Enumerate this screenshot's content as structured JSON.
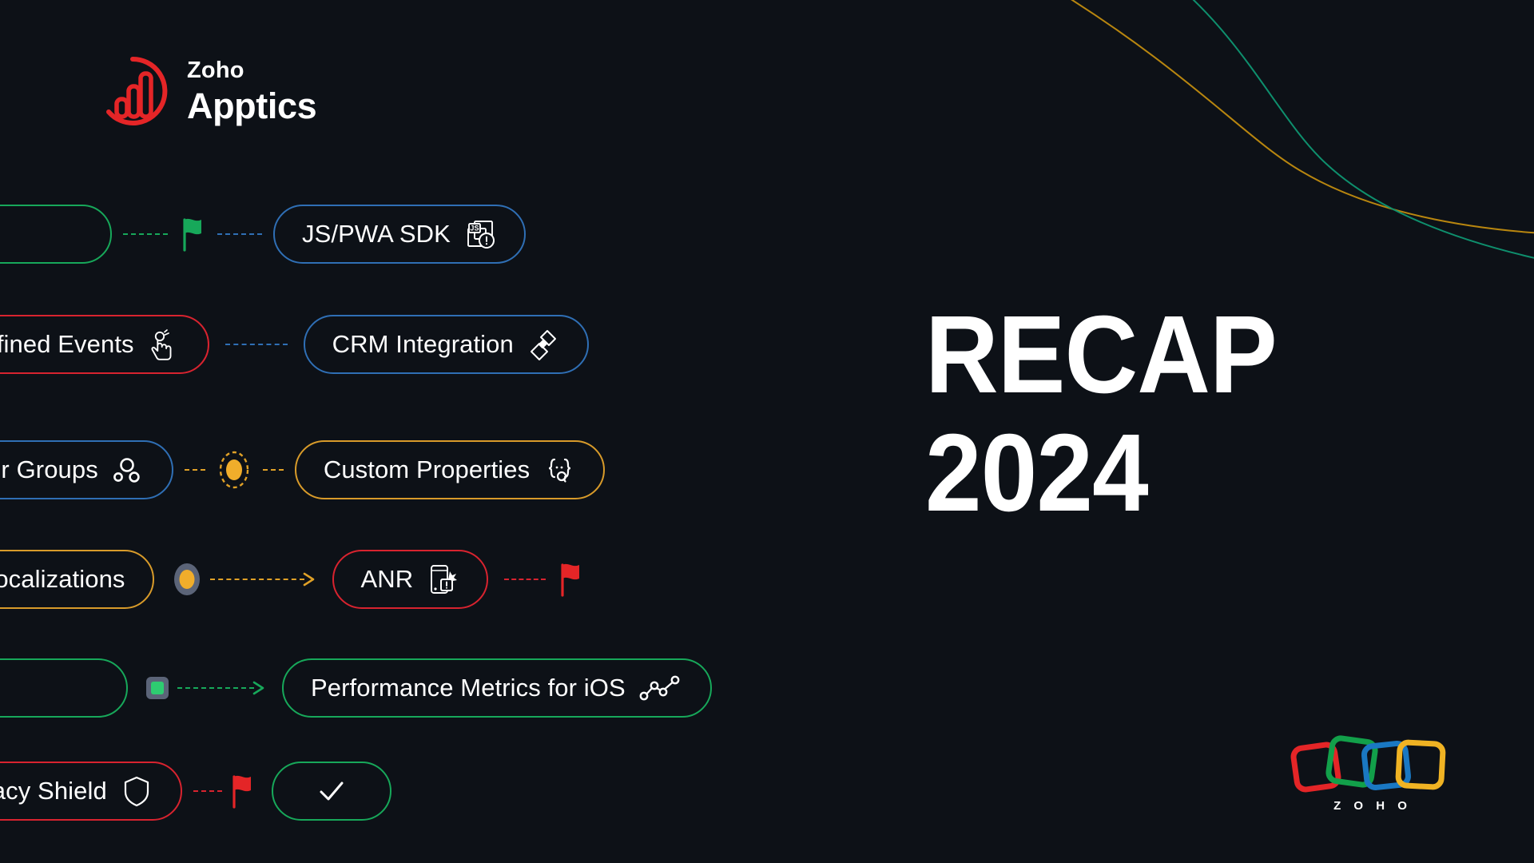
{
  "brand": {
    "logo_icon": "apptics-bar-chart-circle-icon",
    "name_top": "Zoho",
    "name_bottom": "Apptics",
    "accent": "#e42527"
  },
  "headline": {
    "line1": "RECAP",
    "line2": "2024",
    "color": "#ffffff"
  },
  "background": {
    "color": "#0d1117",
    "decorative_curves": [
      {
        "name": "amber-curve",
        "color": "#b8860f"
      },
      {
        "name": "teal-curve",
        "color": "#0e8f6d"
      }
    ]
  },
  "colors": {
    "green": "#17a85a",
    "blue": "#2f6fb5",
    "red": "#d8232f",
    "orange": "#d89b2a",
    "amber_dot": "#f0ad2b",
    "marker_bg": "#5b6478"
  },
  "feature_rows": [
    {
      "id": "row-js-pwa-sdk",
      "items": [
        {
          "type": "pill",
          "name": "pill-partial-green",
          "label": "",
          "color": "green",
          "icon": null,
          "partial": true
        },
        {
          "type": "dash",
          "name": "connector-dashed-green",
          "color": "green",
          "length": 56
        },
        {
          "type": "flag",
          "name": "flag-green-icon",
          "color": "green"
        },
        {
          "type": "dash",
          "name": "connector-dashed-blue",
          "color": "blue",
          "length": 56
        },
        {
          "type": "pill",
          "name": "pill-js-pwa-sdk",
          "label": "JS/PWA SDK",
          "color": "blue",
          "icon": "js-sdk-alert-icon"
        }
      ]
    },
    {
      "id": "row-defined-events",
      "items": [
        {
          "type": "pill",
          "name": "pill-defined-events",
          "label": "Defined Events",
          "color": "red",
          "icon": "tap-cursor-icon"
        },
        {
          "type": "dash",
          "name": "connector-dashed-blue",
          "color": "blue",
          "length": 78
        },
        {
          "type": "pill",
          "name": "pill-crm-integration",
          "label": "CRM Integration",
          "color": "blue",
          "icon": "puzzle-integration-icon"
        }
      ]
    },
    {
      "id": "row-user-groups",
      "items": [
        {
          "type": "pill",
          "name": "pill-user-groups",
          "label": "User Groups",
          "color": "blue",
          "icon": "user-groups-circles-icon"
        },
        {
          "type": "dash",
          "name": "connector-dashed-orange",
          "color": "orange",
          "length": 26
        },
        {
          "type": "marker",
          "name": "marker-dot-dashed-ring",
          "style": "dot-ring",
          "color": "orange"
        },
        {
          "type": "dash",
          "name": "connector-dashed-orange",
          "color": "orange",
          "length": 26
        },
        {
          "type": "pill",
          "name": "pill-custom-properties",
          "label": "Custom Properties",
          "color": "orange",
          "icon": "braces-query-icon"
        }
      ]
    },
    {
      "id": "row-localizations",
      "items": [
        {
          "type": "pill",
          "name": "pill-localizations",
          "label": "Localizations",
          "color": "orange",
          "icon": null
        },
        {
          "type": "marker",
          "name": "marker-dot-pill",
          "style": "dot-pill",
          "color": "orange"
        },
        {
          "type": "arrow",
          "name": "connector-arrow-orange",
          "color": "orange",
          "length": 118
        },
        {
          "type": "pill",
          "name": "pill-anr",
          "label": "ANR",
          "color": "red",
          "icon": "phone-alert-icon"
        },
        {
          "type": "dash",
          "name": "connector-dashed-red",
          "color": "red",
          "length": 52
        },
        {
          "type": "flag",
          "name": "flag-red-icon",
          "color": "red"
        }
      ]
    },
    {
      "id": "row-performance-metrics",
      "items": [
        {
          "type": "pill",
          "name": "pill-partial-green",
          "label": "",
          "color": "green",
          "icon": null,
          "partial": true
        },
        {
          "type": "marker",
          "name": "marker-square-green",
          "style": "square",
          "color": "green"
        },
        {
          "type": "arrow",
          "name": "connector-arrow-green",
          "color": "green",
          "length": 96
        },
        {
          "type": "pill",
          "name": "pill-performance-metrics-ios",
          "label": "Performance Metrics for iOS",
          "color": "green",
          "icon": "trend-line-chart-icon"
        }
      ]
    },
    {
      "id": "row-privacy-shield",
      "items": [
        {
          "type": "pill",
          "name": "pill-privacy-shield",
          "label": "Privacy Shield",
          "color": "red",
          "icon": "shield-icon"
        },
        {
          "type": "dash",
          "name": "connector-dashed-red",
          "color": "red",
          "length": 36
        },
        {
          "type": "flag",
          "name": "flag-red-icon",
          "color": "red"
        },
        {
          "type": "pill",
          "name": "pill-check",
          "label": "",
          "color": "green",
          "icon": "check-icon"
        }
      ]
    }
  ],
  "footer_logo": {
    "name": "zoho-logo",
    "wordmark": "Z O H O",
    "squares": [
      {
        "name": "zoho-square-red",
        "color": "#e42527"
      },
      {
        "name": "zoho-square-green",
        "color": "#12a04a"
      },
      {
        "name": "zoho-square-blue",
        "color": "#1a78c2"
      },
      {
        "name": "zoho-square-yellow",
        "color": "#f0b323"
      }
    ]
  }
}
